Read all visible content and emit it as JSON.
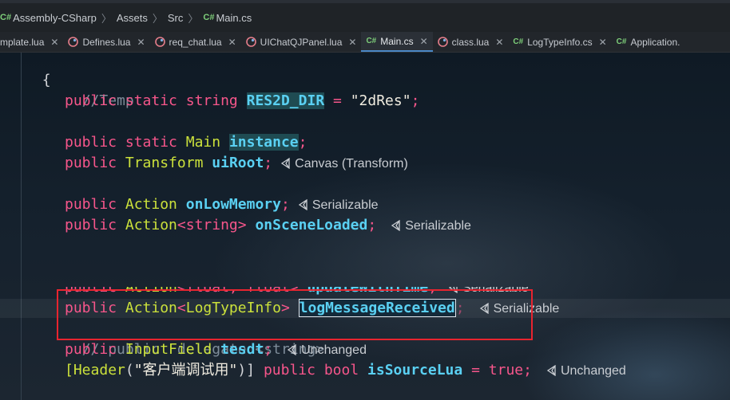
{
  "breadcrumb": {
    "project": "Assembly-CSharp",
    "folder1": "Assets",
    "folder2": "Src",
    "file": "Main.cs",
    "cs_badge": "C#"
  },
  "tabs": [
    {
      "label": "mplate.lua",
      "icon": "lua-icon",
      "active": false
    },
    {
      "label": "Defines.lua",
      "icon": "lua-icon",
      "active": false
    },
    {
      "label": "req_chat.lua",
      "icon": "lua-icon",
      "active": false
    },
    {
      "label": "UIChatQJPanel.lua",
      "icon": "lua-icon",
      "active": false
    },
    {
      "label": "Main.cs",
      "icon": "csharp-icon",
      "active": true
    },
    {
      "label": "class.lua",
      "icon": "lua-icon",
      "active": false
    },
    {
      "label": "LogTypeInfo.cs",
      "icon": "csharp-icon",
      "active": false
    },
    {
      "label": "Application.",
      "icon": "csharp-icon",
      "active": false
    }
  ],
  "code": {
    "brace": "{",
    "comment_temp": "//Temp",
    "kw_public": "public",
    "kw_static": "static",
    "kw_string": "string",
    "kw_bool": "bool",
    "val_true": "true",
    "res_field": "RES2D_DIR",
    "res_value": "\"2dRes\"",
    "eq": "=",
    "semi": ";",
    "type_main": "Main",
    "instance_field": "instance",
    "type_transform": "Transform",
    "uiroot_field": "uiRoot",
    "type_action": "Action",
    "onlowmemory_field": "onLowMemory",
    "generic_string_open": "<",
    "generic_string_type": "string",
    "generic_close": ">",
    "onsceneloaded_field": "onSceneLoaded",
    "generic_float": "<float, float>",
    "updatewithtime_field": "updateWithTime",
    "type_logtypeinfo": "LogTypeInfo",
    "logmessagereceived_field": "logMessageReceived",
    "comment_delegate": "// public  delegate <string>",
    "type_inputfield": "InputField",
    "tesdt_field": "tesdt",
    "attr_open": "[",
    "attr_header": "Header",
    "attr_paren_open": "(",
    "attr_string": "\"客户端调试用\"",
    "attr_close": ")]",
    "issourcelua_field": "isSourceLua"
  },
  "hints": {
    "canvas": "Canvas (Transform)",
    "serializable": "Serializable",
    "unchanged": "Unchanged",
    "icon": "unity-icon"
  }
}
